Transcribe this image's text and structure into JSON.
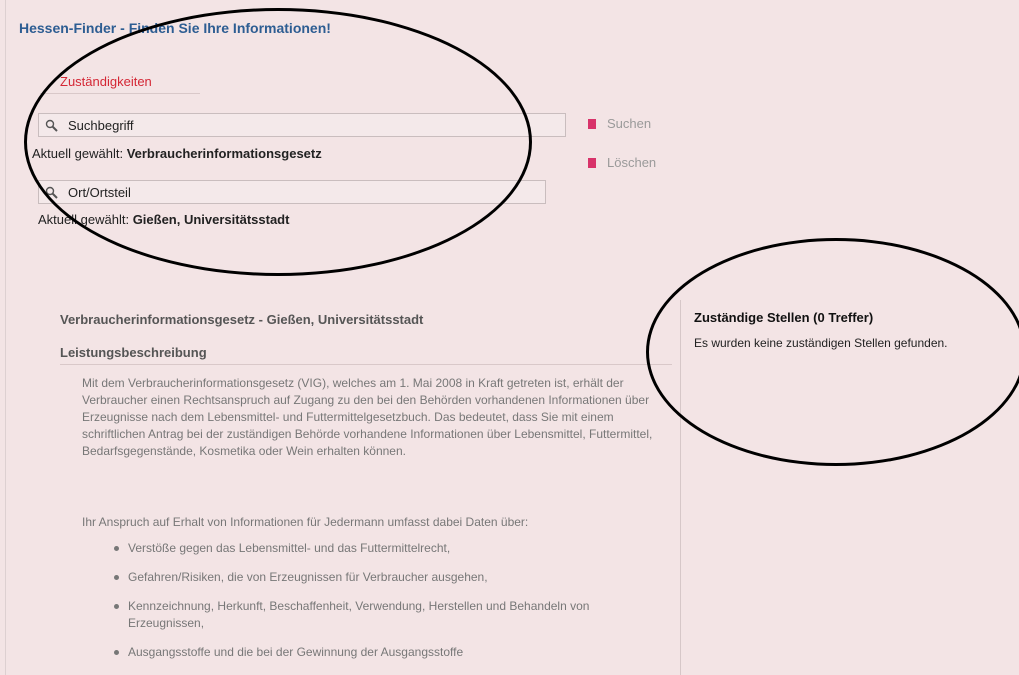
{
  "header": {
    "title": "Hessen-Finder - Finden Sie Ihre Informationen!"
  },
  "tabs": [
    {
      "label": "Zuständigkeiten"
    }
  ],
  "search": {
    "term_value": "Suchbegriff",
    "term_selected_prefix": "Aktuell gewählt:",
    "term_selected_value": "Verbraucherinformationsgesetz",
    "location_value": "Ort/Ortsteil",
    "location_selected_prefix": "Aktuell gewählt:",
    "location_selected_value": "Gießen, Universitätsstadt",
    "search_label": "Suchen",
    "clear_label": "Löschen",
    "icon": "magnifier-icon"
  },
  "result": {
    "title": "Verbraucherinformationsgesetz - Gießen, Universitätsstadt",
    "section_title": "Leistungsbeschreibung",
    "paragraphs": [
      "Mit dem Verbraucherinformationsgesetz (VIG), welches am 1. Mai 2008 in Kraft getreten ist, erhält der Verbraucher einen Rechtsanspruch auf Zugang zu den bei den Behörden vorhandenen Informationen über Erzeugnisse nach dem Lebensmittel- und Futtermittelgesetzbuch. Das bedeutet, dass Sie mit einem schriftlichen Antrag bei der zuständigen Behörde vorhandene Informationen über Lebensmittel, Futtermittel, Bedarfsgegenstände, Kosmetika oder Wein erhalten können.",
      "Ihr Anspruch auf Erhalt von Informationen für Jedermann umfasst dabei Daten über:"
    ],
    "bullets": [
      "Verstöße gegen das Lebensmittel- und das Futtermittelrecht,",
      "Gefahren/Risiken, die von Erzeugnissen für Verbraucher ausgehen,",
      "Kennzeichnung, Herkunft, Beschaffenheit, Verwendung, Herstellen und Behandeln von Erzeugnissen,",
      "Ausgangsstoffe und die bei der Gewinnung der Ausgangsstoffe"
    ]
  },
  "sidebar": {
    "title": "Zuständige Stellen (0 Treffer)",
    "message": "Es wurden keine zuständigen Stellen gefunden."
  },
  "colors": {
    "background": "#f3e4e5",
    "title_blue": "#2d5d92",
    "tab_red": "#d42735",
    "button_pink": "#d8336a"
  }
}
